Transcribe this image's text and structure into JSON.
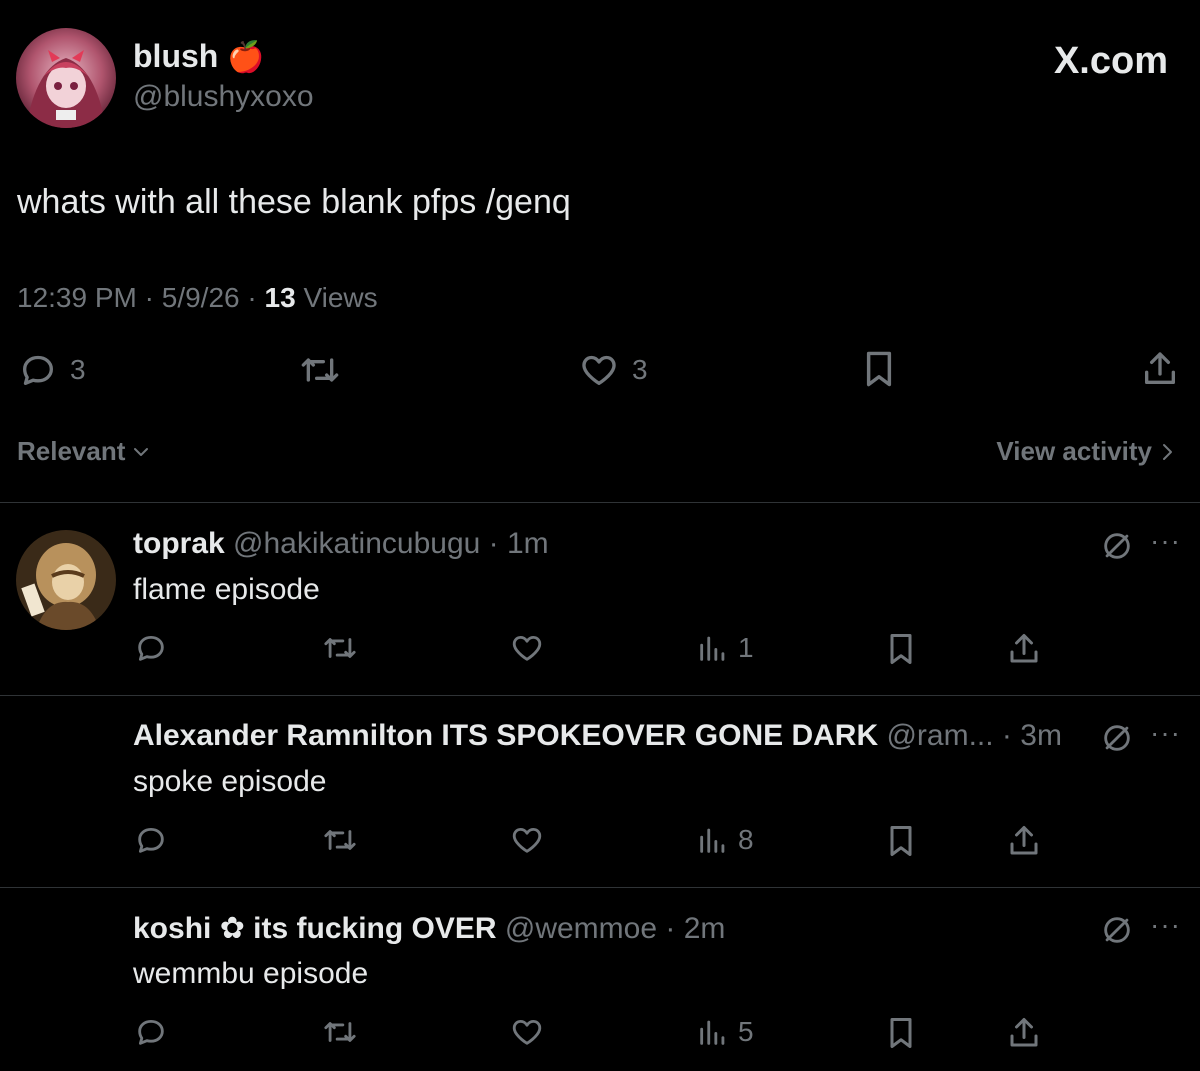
{
  "tweet": {
    "author_name": "blush",
    "author_emoji": "🍎",
    "author_handle": "@blushyxoxo",
    "brand": "X.com",
    "text": "whats with all these blank pfps /genq",
    "time": "12:39 PM",
    "date": "5/9/26",
    "views_count": "13",
    "views_label": "Views",
    "reply_count": "3",
    "like_count": "3"
  },
  "sort": {
    "label": "Relevant",
    "view_activity": "View activity"
  },
  "replies": [
    {
      "name": "toprak",
      "handle": "@hakikatincubugu",
      "time": "1m",
      "text": "flame episode",
      "views": "1",
      "has_avatar": true
    },
    {
      "name": "Alexander Ramnilton ITS SPOKEOVER GONE DARK",
      "handle": "@ram...",
      "time": "3m",
      "text": "spoke episode",
      "views": "8",
      "has_avatar": false
    },
    {
      "name": "koshi ✿ its fucking OVER",
      "handle": "@wemmoe",
      "time": "2m",
      "text": "wemmbu episode",
      "views": "5",
      "has_avatar": false
    }
  ],
  "icons": {
    "reply": "reply-icon",
    "retweet": "retweet-icon",
    "like": "heart-icon",
    "bookmark": "bookmark-icon",
    "share": "share-icon",
    "views": "views-icon",
    "grok": "grok-icon",
    "more": "more-icon",
    "chevron": "chevron-icon"
  },
  "colors": {
    "background": "#000000",
    "text": "#e7e9ea",
    "muted": "#71767b",
    "divider": "#2f3336"
  }
}
